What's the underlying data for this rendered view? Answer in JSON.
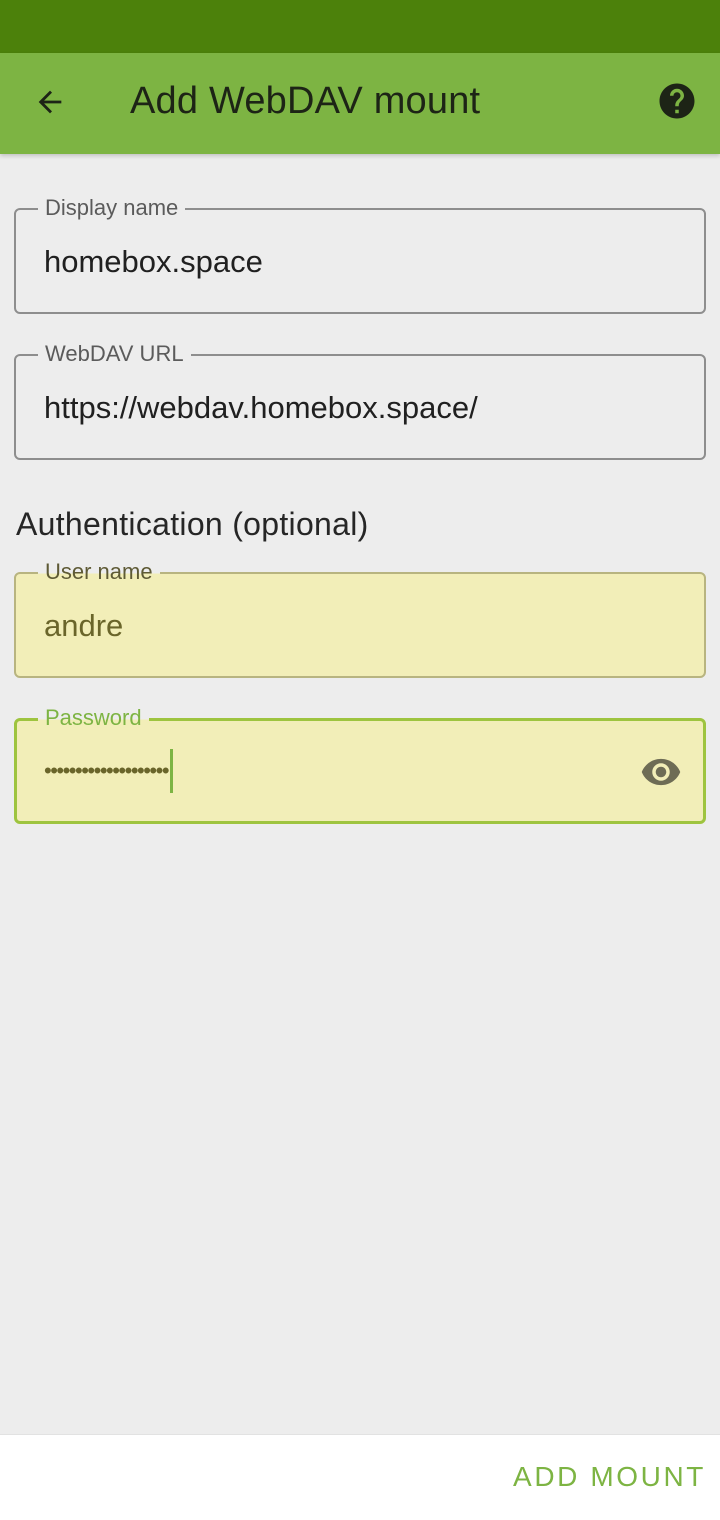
{
  "app_bar": {
    "title": "Add WebDAV mount",
    "back_icon": "arrow-back-icon",
    "help_icon": "help-circle-icon"
  },
  "fields": {
    "display_name": {
      "label": "Display name",
      "value": "homebox.space"
    },
    "webdav_url": {
      "label": "WebDAV URL",
      "value": "https://webdav.homebox.space/"
    },
    "user_name": {
      "label": "User name",
      "value": "andre"
    },
    "password": {
      "label": "Password",
      "value": "••••••••••••••••••••",
      "visibility_icon": "eye-icon"
    }
  },
  "section": {
    "authentication_title": "Authentication (optional)"
  },
  "footer": {
    "add_mount_label": "ADD MOUNT"
  },
  "colors": {
    "status_bar": "#4c810b",
    "app_bar": "#7db443",
    "accent": "#7db443",
    "autofill_bg": "#f2eeb8",
    "background": "#ededed"
  }
}
